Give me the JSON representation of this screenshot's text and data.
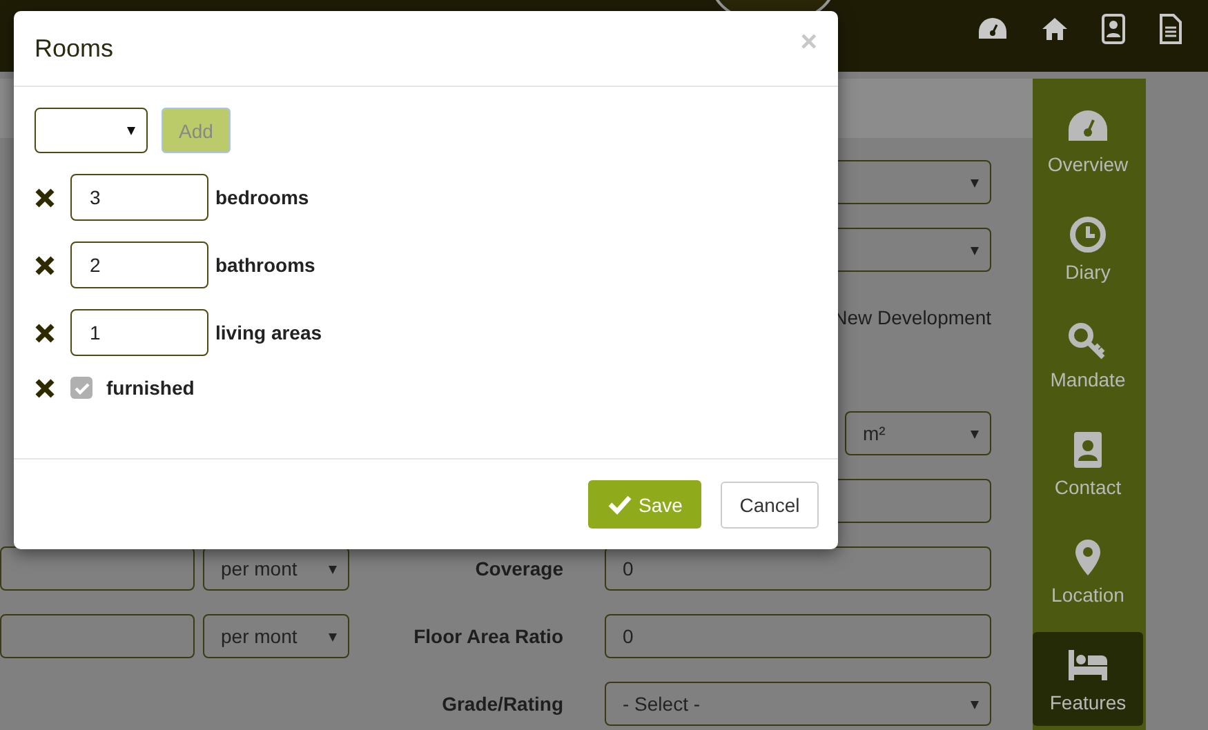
{
  "sidebar": {
    "items": [
      {
        "label": "Overview",
        "selected": false
      },
      {
        "label": "Diary",
        "selected": false
      },
      {
        "label": "Mandate",
        "selected": false
      },
      {
        "label": "Contact",
        "selected": false
      },
      {
        "label": "Location",
        "selected": false
      },
      {
        "label": "Features",
        "selected": true
      }
    ]
  },
  "form_rows": [
    {
      "kind": "select"
    },
    {
      "kind": "select"
    },
    {
      "kind": "text",
      "text": "New Development"
    },
    {
      "kind": "unit",
      "unit": "m²"
    },
    {
      "kind": "input"
    },
    {
      "kind": "priced",
      "period": "per mont",
      "label": "Coverage",
      "value": "0"
    },
    {
      "kind": "priced",
      "period": "per mont",
      "label": "Floor Area Ratio",
      "value": "0"
    },
    {
      "kind": "choice",
      "label": "Grade/Rating",
      "value": "- Select -"
    }
  ],
  "modal": {
    "title": "Rooms",
    "close": "×",
    "add_button": {
      "label": "Add",
      "disabled": true
    },
    "rooms": [
      {
        "kind": "count",
        "value": "3",
        "label": "bedrooms"
      },
      {
        "kind": "count",
        "value": "2",
        "label": "bathrooms"
      },
      {
        "kind": "count",
        "value": "1",
        "label": "living areas"
      },
      {
        "kind": "check",
        "label": "furnished",
        "checked": true,
        "disabled": true
      }
    ],
    "buttons": [
      {
        "label": "Save",
        "kind": "primary"
      },
      {
        "label": "Cancel",
        "kind": "default"
      }
    ]
  }
}
